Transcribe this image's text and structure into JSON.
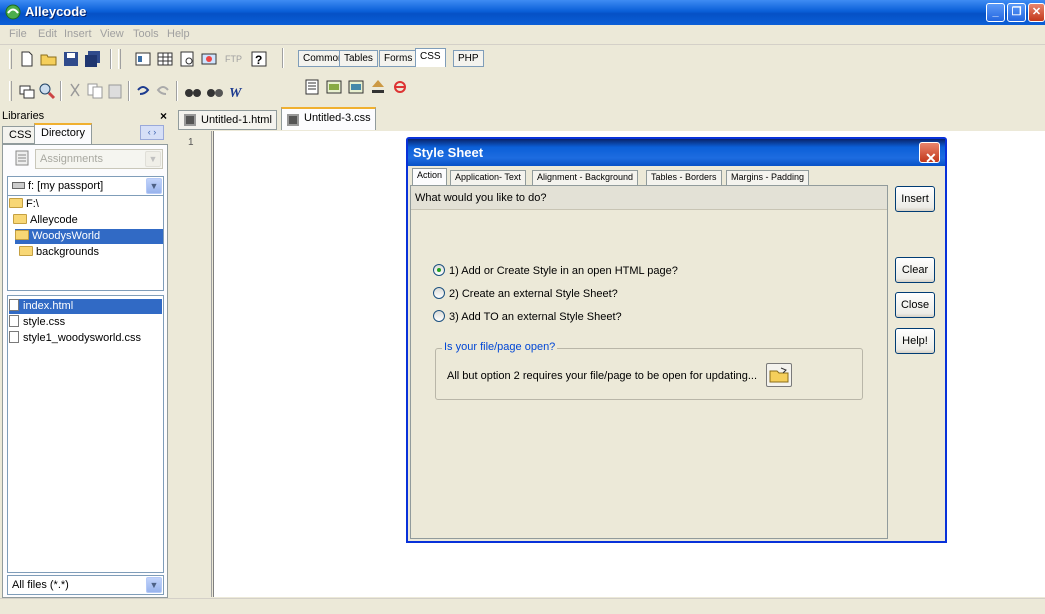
{
  "app": {
    "title": "Alleycode"
  },
  "window_controls": {
    "minimize": "_",
    "restore": "❐",
    "close": "✕"
  },
  "menu": [
    "File",
    "Edit",
    "Insert",
    "View",
    "Tools",
    "Help"
  ],
  "toolbar": {
    "ftp_label": "FTP",
    "insert_tabs": [
      "Common",
      "Tables",
      "Forms",
      "CSS",
      "PHP"
    ],
    "active_insert_tab": "CSS"
  },
  "libraries": {
    "title": "Libraries",
    "close": "×",
    "tabs": [
      "CSS",
      "Directory"
    ],
    "active_tab": "Directory",
    "arrows": "‹ ›",
    "assignments_placeholder": "Assignments",
    "drive": "f: [my passport]",
    "folders": [
      "F:\\",
      "Alleycode",
      "WoodysWorld",
      "backgrounds"
    ],
    "selected_folder": "WoodysWorld",
    "files": [
      "index.html",
      "style.css",
      "style1_woodysworld.css"
    ],
    "selected_file": "index.html",
    "filter": "All files (*.*)"
  },
  "editor": {
    "tabs": [
      "Untitled-1.html",
      "Untitled-3.css"
    ],
    "active_tab": "Untitled-3.css",
    "line_number": "1"
  },
  "dialog": {
    "title": "Style Sheet",
    "tabs": [
      "Action",
      "Application- Text",
      "Alignment - Background",
      "Tables - Borders",
      "Margins - Padding"
    ],
    "active_tab": "Action",
    "question": "What would you like to do?",
    "options": [
      "1) Add or Create Style in an open HTML page?",
      "2) Create an external Style Sheet?",
      "3) Add TO an external Style Sheet?"
    ],
    "selected_option": 0,
    "group_title": "Is your file/page open?",
    "group_text": "All but option 2 requires your file/page to be open for updating...",
    "buttons": {
      "insert": "Insert",
      "clear": "Clear",
      "close": "Close",
      "help": "Help!"
    },
    "close_glyph": "✕"
  },
  "colors": {
    "titlebar": "#0b5fd7",
    "selection": "#316ac5",
    "dialog_border": "#0831d9",
    "group_legend": "#0046d5"
  }
}
